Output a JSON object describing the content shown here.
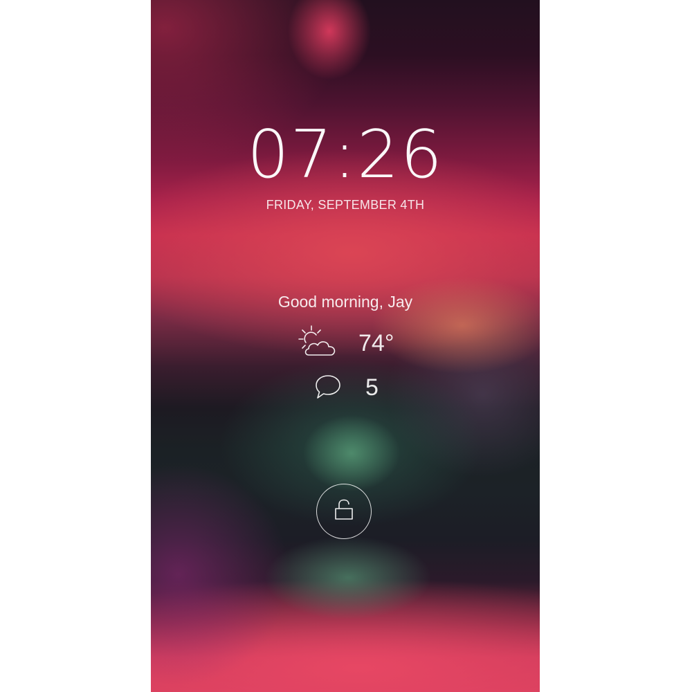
{
  "lockscreen": {
    "time": "07:26",
    "date": "FRIDAY, SEPTEMBER 4TH",
    "greeting": "Good morning, Jay",
    "weather": {
      "icon": "partly-sunny-icon",
      "temperature": "74°"
    },
    "messages": {
      "icon": "speech-bubble-icon",
      "count": "5"
    },
    "unlock": {
      "icon": "unlocked-padlock-icon"
    }
  },
  "colors": {
    "text": "#ffffff",
    "wallpaper_top": "#22101f",
    "wallpaper_pink": "#c52e4f",
    "wallpaper_green": "#4f9070",
    "wallpaper_bottom": "#d53d5e"
  }
}
